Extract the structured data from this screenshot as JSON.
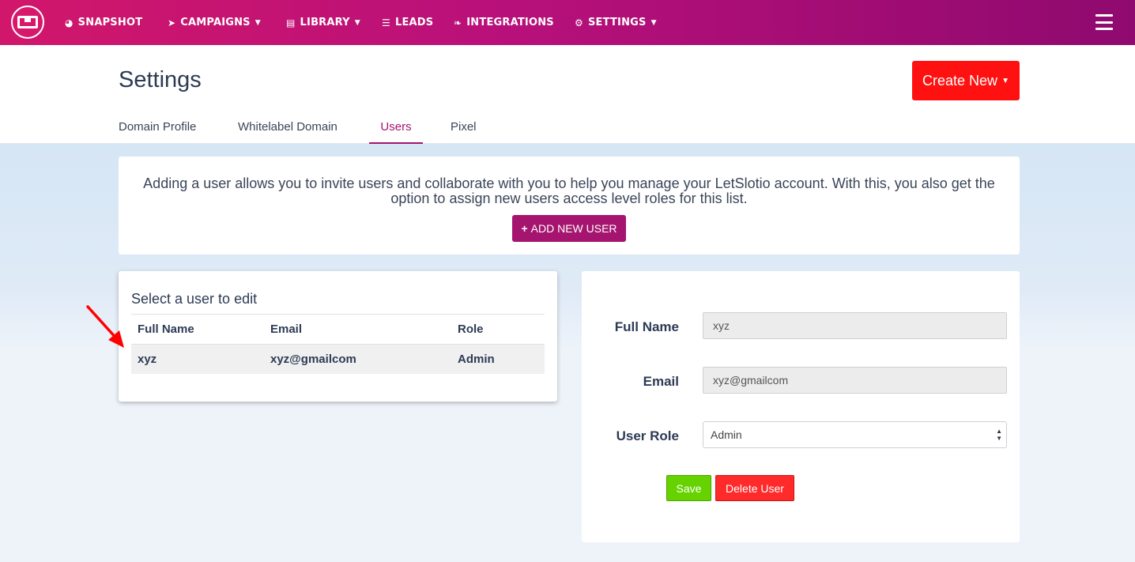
{
  "nav": {
    "items": [
      {
        "label": "SNAPSHOT",
        "icon": "dashboard-icon",
        "has_caret": false
      },
      {
        "label": "CAMPAIGNS",
        "icon": "paper-plane-icon",
        "has_caret": true
      },
      {
        "label": "LIBRARY",
        "icon": "list-icon",
        "has_caret": true
      },
      {
        "label": "LEADS",
        "icon": "list-bullets-icon",
        "has_caret": false
      },
      {
        "label": "INTEGRATIONS",
        "icon": "plug-icon",
        "has_caret": false
      },
      {
        "label": "SETTINGS",
        "icon": "gears-icon",
        "has_caret": true
      }
    ]
  },
  "header": {
    "title": "Settings",
    "create_button": "Create New",
    "tabs": [
      {
        "label": "Domain Profile",
        "active": false
      },
      {
        "label": "Whitelabel Domain",
        "active": false
      },
      {
        "label": "Users",
        "active": true
      },
      {
        "label": "Pixel",
        "active": false
      }
    ]
  },
  "intro": {
    "text": "Adding a user allows you to invite users and collaborate with you to help you manage your LetSlotio account. With this, you also get the option to assign new users access level roles for this list.",
    "add_button": "ADD NEW USER"
  },
  "user_list": {
    "title": "Select a user to edit",
    "columns": [
      "Full Name",
      "Email",
      "Role"
    ],
    "rows": [
      {
        "full_name": "xyz",
        "email": "xyz@gmailcom",
        "role": "Admin"
      }
    ]
  },
  "form": {
    "full_name_label": "Full Name",
    "full_name_value": "xyz",
    "email_label": "Email",
    "email_value": "xyz@gmailcom",
    "role_label": "User Role",
    "role_value": "Admin",
    "save_label": "Save",
    "delete_label": "Delete User"
  },
  "colors": {
    "nav_gradient_start": "#d1176b",
    "nav_gradient_end": "#8f0a6f",
    "accent": "#a5146f",
    "create_button": "#ff1111",
    "save_button": "#66d300",
    "delete_button": "#ff2a2a",
    "annotation_arrow": "#ff0000"
  }
}
